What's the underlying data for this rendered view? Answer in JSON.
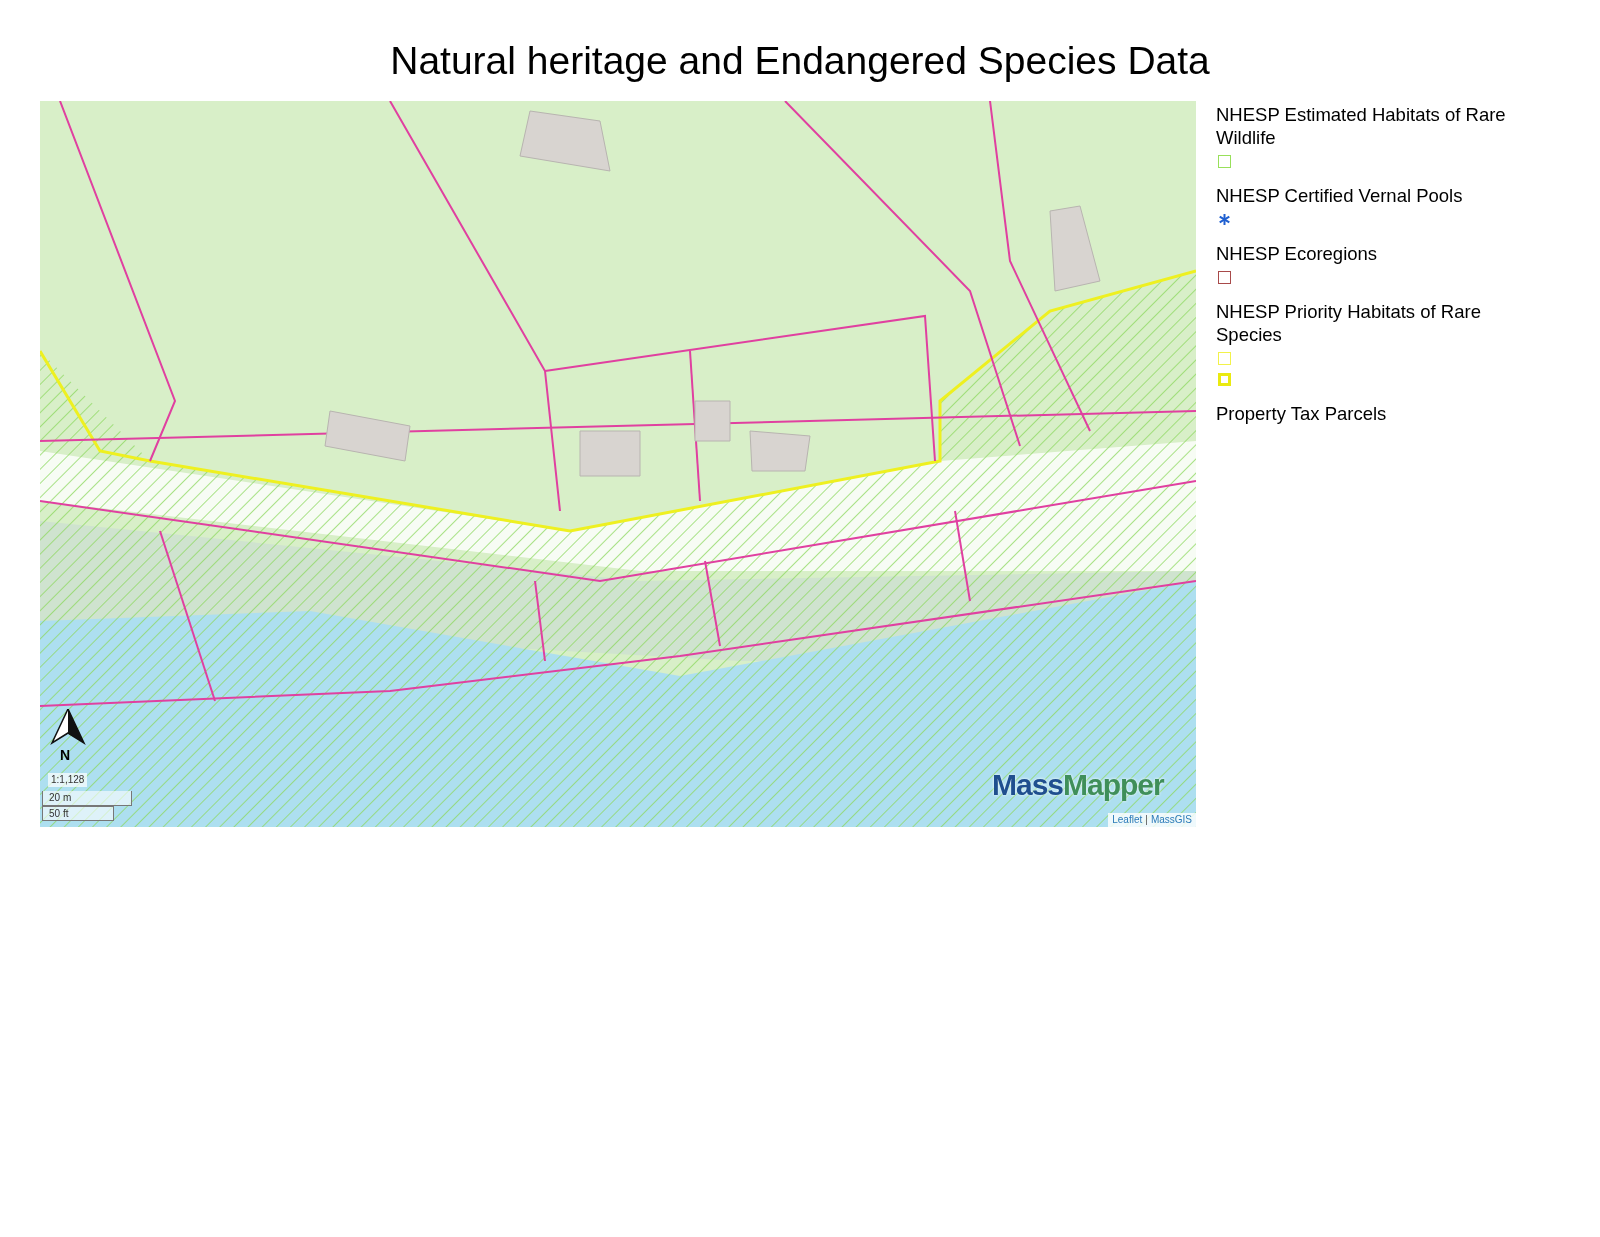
{
  "title": "Natural heritage and Endangered Species Data",
  "map": {
    "scale_ratio": "1:1,128",
    "scale_metric": "20 m",
    "scale_imperial": "50 ft",
    "north_label": "N",
    "logo": {
      "part_1": "Mass",
      "part_2": "Mapper"
    },
    "attribution": {
      "link_1": "Leaflet",
      "separator": "|",
      "link_2": "MassGIS"
    }
  },
  "legend": [
    {
      "label": "NHESP Estimated Habitats of Rare Wildlife",
      "symbols": [
        {
          "kind": "square",
          "color": "#98e05a"
        }
      ]
    },
    {
      "label": "NHESP Certified Vernal Pools",
      "symbols": [
        {
          "kind": "asterisk",
          "color": "#1f5fd0"
        }
      ]
    },
    {
      "label": "NHESP Ecoregions",
      "symbols": [
        {
          "kind": "square",
          "color": "#a84a4a"
        }
      ]
    },
    {
      "label": "NHESP Priority Habitats of Rare Species",
      "symbols": [
        {
          "kind": "square",
          "color": "#f2f24a"
        },
        {
          "kind": "square-thick",
          "color": "#eaea10"
        }
      ]
    },
    {
      "label": "Property Tax Parcels"
    }
  ]
}
